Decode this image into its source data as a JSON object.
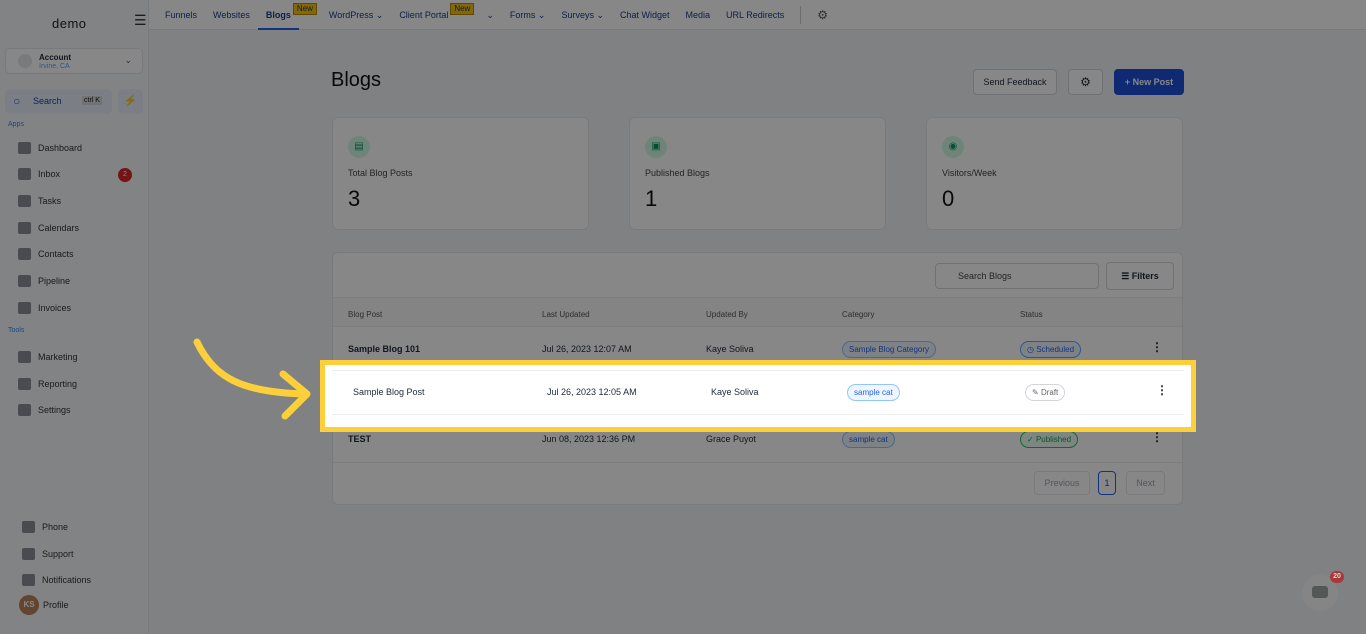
{
  "sidebar": {
    "logo": "demo",
    "account": {
      "name": "Account",
      "location": "Irvine, CA"
    },
    "search": {
      "label": "Search",
      "shortcut": "ctrl K"
    },
    "apps_label": "Apps",
    "tools_label": "Tools",
    "apps": [
      {
        "label": "Dashboard"
      },
      {
        "label": "Inbox",
        "badge": "2"
      },
      {
        "label": "Tasks"
      },
      {
        "label": "Calendars"
      },
      {
        "label": "Contacts"
      },
      {
        "label": "Pipeline"
      },
      {
        "label": "Invoices"
      }
    ],
    "tools": [
      {
        "label": "Marketing"
      },
      {
        "label": "Reporting"
      },
      {
        "label": "Settings"
      }
    ],
    "bottom": [
      {
        "label": "Phone"
      },
      {
        "label": "Support"
      },
      {
        "label": "Notifications"
      },
      {
        "label": "Profile",
        "initials": "KS"
      }
    ]
  },
  "topnav": {
    "items": [
      "Funnels",
      "Websites",
      "Blogs",
      "WordPress",
      "Client Portal",
      "Forms",
      "Surveys",
      "Chat Widget",
      "Media",
      "URL Redirects"
    ],
    "new_badge": "New",
    "active": "Blogs"
  },
  "page": {
    "title": "Blogs",
    "send_feedback": "Send Feedback",
    "new_post": "+ New Post"
  },
  "stats": [
    {
      "label": "Total Blog Posts",
      "value": "3"
    },
    {
      "label": "Published Blogs",
      "value": "1"
    },
    {
      "label": "Visitors/Week",
      "value": "0"
    }
  ],
  "table": {
    "search_placeholder": "Search Blogs",
    "filters": "Filters",
    "headers": [
      "Blog Post",
      "Last Updated",
      "Updated By",
      "Category",
      "Status"
    ],
    "rows": [
      {
        "title": "Sample Blog 101",
        "updated": "Jul 26, 2023 12:07 AM",
        "by": "Kaye Soliva",
        "category": "Sample Blog Category",
        "status": "Scheduled"
      },
      {
        "title": "Sample Blog Post",
        "updated": "Jul 26, 2023 12:05 AM",
        "by": "Kaye Soliva",
        "category": "sample cat",
        "status": "Draft"
      },
      {
        "title": "TEST",
        "updated": "Jun 08, 2023 12:36 PM",
        "by": "Grace Puyot",
        "category": "sample cat",
        "status": "Published"
      }
    ],
    "pagination": {
      "previous": "Previous",
      "page": "1",
      "next": "Next"
    }
  },
  "chat": {
    "count": "20"
  },
  "colors": {
    "accent": "#2563eb",
    "highlight": "#fccf3b"
  }
}
